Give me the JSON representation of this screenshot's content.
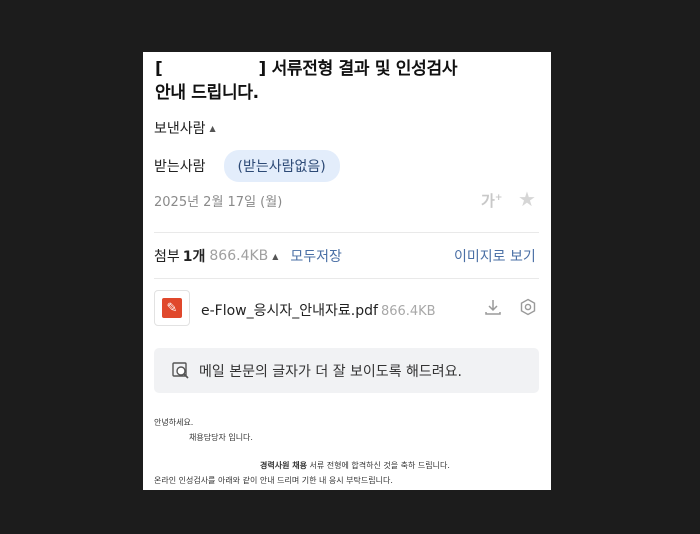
{
  "mail": {
    "subject_open": "[",
    "subject_rest": "] 서류전형 결과 및 인성검사",
    "subject_line2": "안내 드립니다.",
    "sender_label": "보낸사람",
    "recipient_label": "받는사람",
    "recipient_chip": "(받는사람없음)",
    "date": "2025년 2월 17일 (월)",
    "font_size_icon": "가"
  },
  "attachments": {
    "label": "첨부",
    "count": "1개",
    "total_size": "866.4KB",
    "save_all": "모두저장",
    "view_as_image": "이미지로 보기",
    "file": {
      "name": "e-Flow_응시자_안내자료.pdf",
      "size": "866.4KB",
      "icon": "pdf-icon"
    }
  },
  "notice": {
    "text": "메일 본문의 글자가 더 잘 보이도록 해드려요."
  },
  "body": {
    "line1": "안녕하세요.",
    "line2": "채용담당자 입니다.",
    "line3_bold": "경력사원 채용",
    "line3_rest": " 서류 전형에 합격하신 것을 축하 드립니다.",
    "line4": "온라인 인성검사를 아래와 같이 안내 드리며 기한 내 응시 부탁드립니다."
  },
  "colors": {
    "accent_link": "#4a6fa5",
    "chip_bg": "#e3edfb",
    "pdf_red": "#e0482c",
    "backdrop": "#1c1c1c"
  }
}
